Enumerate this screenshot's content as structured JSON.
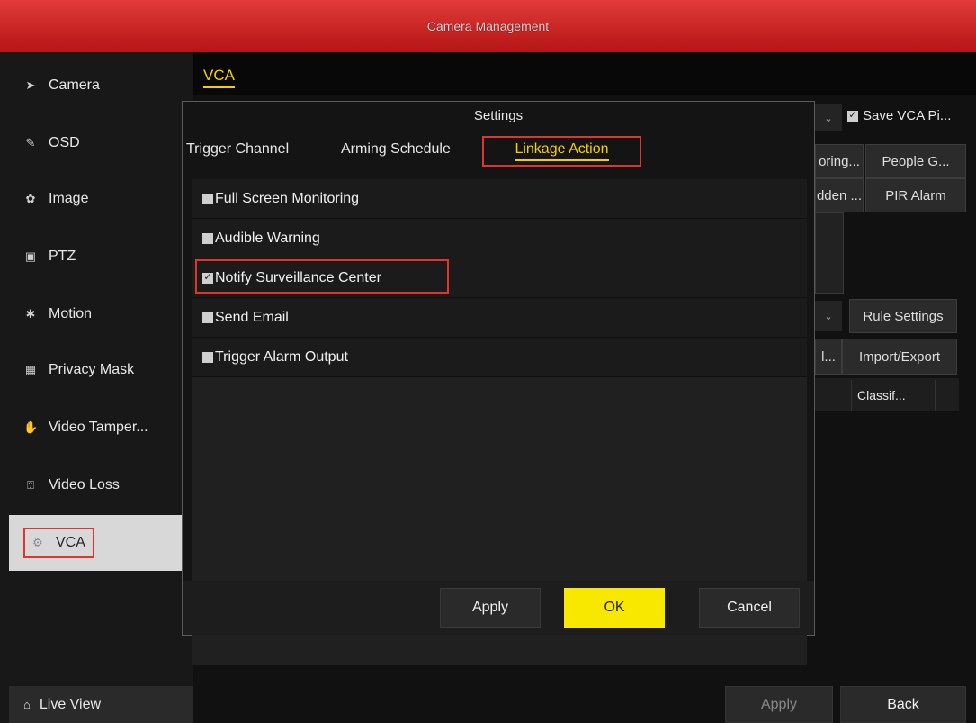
{
  "window": {
    "title": "Camera Management"
  },
  "sidebar": {
    "items": [
      {
        "label": "Camera",
        "icon": "camera-icon"
      },
      {
        "label": "OSD",
        "icon": "osd-icon"
      },
      {
        "label": "Image",
        "icon": "image-icon"
      },
      {
        "label": "PTZ",
        "icon": "ptz-icon"
      },
      {
        "label": "Motion",
        "icon": "motion-icon"
      },
      {
        "label": "Privacy Mask",
        "icon": "privacy-mask-icon"
      },
      {
        "label": "Video Tamper...",
        "icon": "video-tamper-icon"
      },
      {
        "label": "Video Loss",
        "icon": "video-loss-icon"
      },
      {
        "label": "VCA",
        "icon": "vca-icon",
        "active": true
      }
    ],
    "live_view": "Live View"
  },
  "main": {
    "tab": "VCA",
    "save_vca": "Save VCA Pi...",
    "buttons": {
      "oring": "oring...",
      "people": "People G...",
      "dden": "dden ...",
      "pir": "PIR Alarm",
      "rule_settings": "Rule Settings",
      "l_trunc": "l...",
      "import_export": "Import/Export",
      "classif": "Classif..."
    },
    "apply": "Apply",
    "back": "Back"
  },
  "dialog": {
    "title": "Settings",
    "tabs": [
      "Trigger Channel",
      "Arming Schedule",
      "Linkage Action"
    ],
    "active_tab": "Linkage Action",
    "options": [
      {
        "label": "Full Screen Monitoring",
        "checked": false
      },
      {
        "label": "Audible Warning",
        "checked": false
      },
      {
        "label": "Notify Surveillance Center",
        "checked": true
      },
      {
        "label": "Send Email",
        "checked": false
      },
      {
        "label": "Trigger Alarm Output",
        "checked": false
      }
    ],
    "buttons": {
      "apply": "Apply",
      "ok": "OK",
      "cancel": "Cancel"
    }
  },
  "colors": {
    "title_red": "#d22a2a",
    "accent_yellow": "#f8e800",
    "highlight_red": "#e0342f"
  }
}
